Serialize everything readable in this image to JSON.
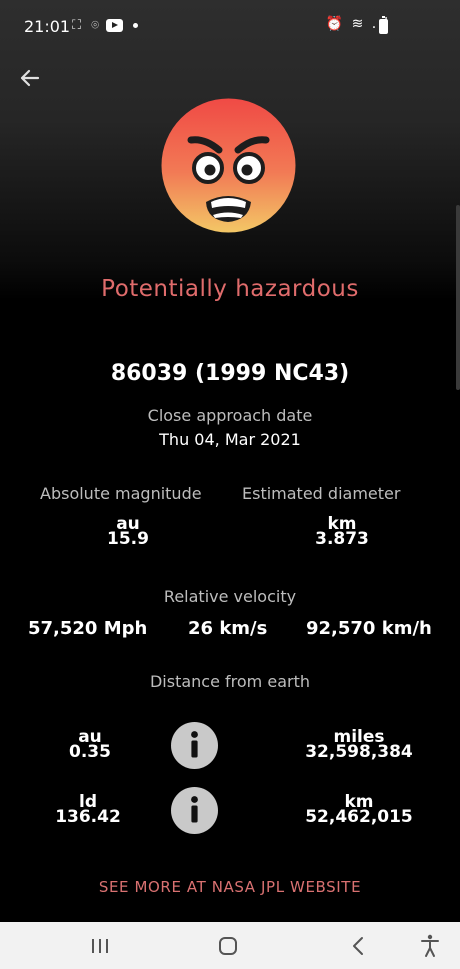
{
  "status_bar": {
    "time": "21:01",
    "left_icons": "⛶ ⌾",
    "right_icons": "⏰ ≋ .ıl"
  },
  "header": {
    "back_icon": "arrow-left-icon",
    "emoji_icon": "angry-face-icon"
  },
  "asteroid": {
    "hazard_status": "Potentially hazardous",
    "name": "86039 (1999 NC43)",
    "close_approach_label": "Close approach date",
    "close_approach_date": "Thu 04, Mar 2021"
  },
  "magnitude": {
    "title": "Absolute magnitude",
    "unit": "au",
    "value": "15.9"
  },
  "diameter": {
    "title": "Estimated diameter",
    "unit": "km",
    "value": "3.873"
  },
  "velocity": {
    "title": "Relative velocity",
    "mph": "57,520 Mph",
    "kms": "26 km/s",
    "kmh": "92,570 km/h"
  },
  "distance": {
    "title": "Distance from earth",
    "au_unit": "au",
    "au_value": "0.35",
    "ld_unit": "ld",
    "ld_value": "136.42",
    "miles_unit": "miles",
    "miles_value": "32,598,384",
    "km_unit": "km",
    "km_value": "52,462,015"
  },
  "link": {
    "label": "SEE MORE AT NASA JPL WEBSITE"
  },
  "nav_bar": {
    "icons": [
      "recent-apps-icon",
      "home-icon",
      "back-icon",
      "accessibility-icon"
    ]
  },
  "colors": {
    "hazard": "#e06c6c",
    "link": "#d97171",
    "info_button": "#c9c9c9"
  }
}
